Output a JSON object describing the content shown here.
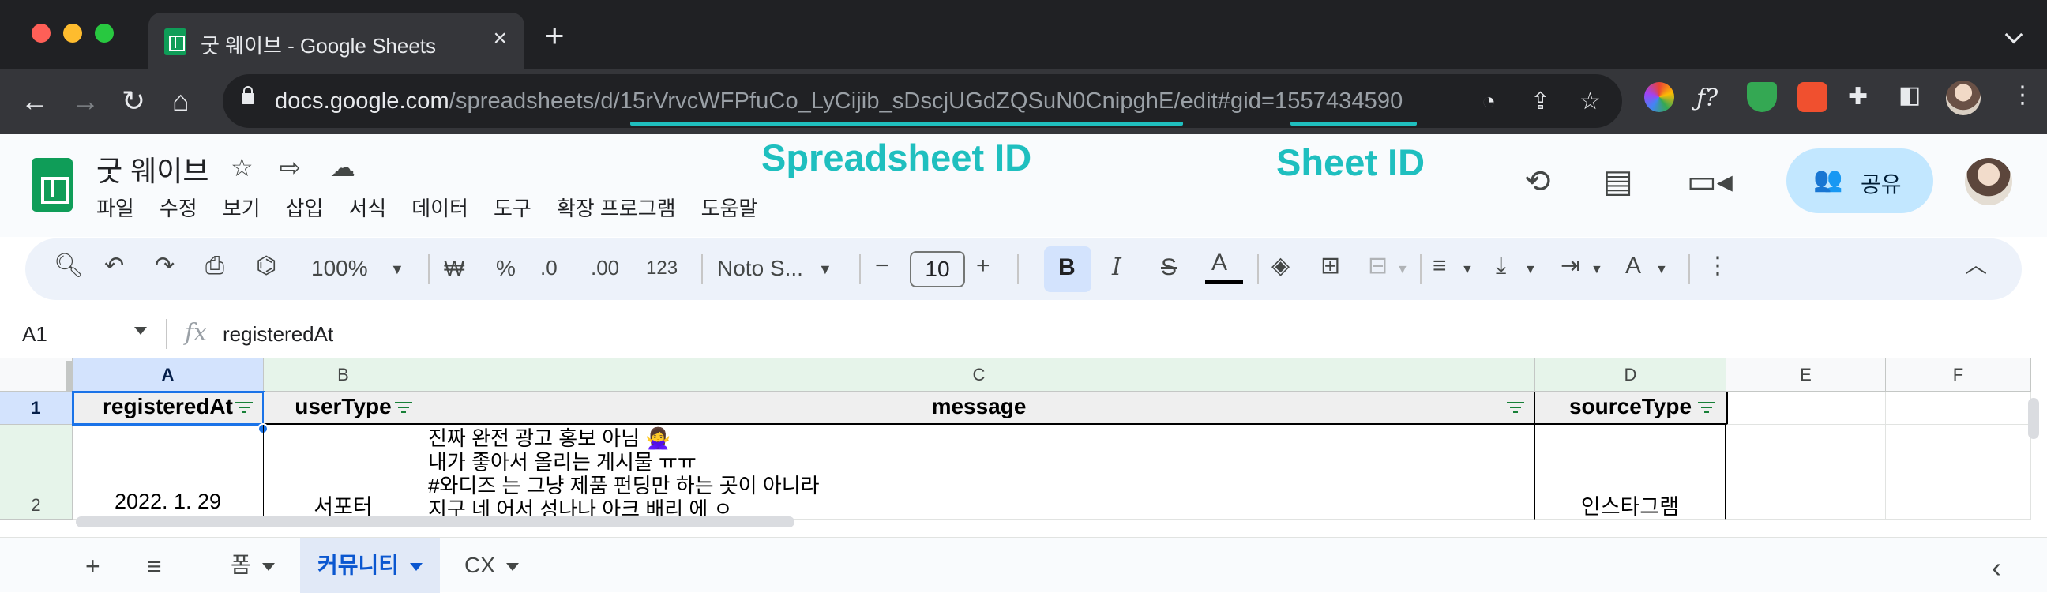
{
  "browser": {
    "tab_title": "굿 웨이브 - Google Sheets",
    "tab_close": "×",
    "new_tab": "+",
    "url_host": "docs.google.com",
    "url_path": "/spreadsheets/d/15rVrvcWFPfuCo_LyCijib_sDscjUGdZQSuN0CnipghE/edit#gid=1557434590",
    "nav": {
      "back": "←",
      "forward": "→",
      "reload": "↻",
      "home": "⌂"
    },
    "omni_icons": [
      "speedometer-icon",
      "share-icon",
      "star-icon"
    ],
    "extensions": [
      "color-picker-icon",
      "formula-icon",
      "shield-icon",
      "translate-icon",
      "puzzle-icon",
      "sidebar-icon"
    ]
  },
  "sheets": {
    "doc_title": "굿 웨이브",
    "menu": [
      "파일",
      "수정",
      "보기",
      "삽입",
      "서식",
      "데이터",
      "도구",
      "확장 프로그램",
      "도움말"
    ],
    "share_label": "공유"
  },
  "annotations": {
    "spreadsheet_id_label": "Spreadsheet ID",
    "sheet_id_label": "Sheet ID",
    "accent_color": "#1fbfbf"
  },
  "format_toolbar": {
    "zoom": "100%",
    "currency": "₩",
    "percent": "%",
    "decrease_decimal": ".0",
    "increase_decimal": ".00",
    "number_format": "123",
    "font": "Noto S...",
    "font_size": "10",
    "bold": "B",
    "italic": "I",
    "strike": "S",
    "text_color": "A"
  },
  "formula_bar": {
    "cell_ref": "A1",
    "fx": "fx",
    "value": "registeredAt"
  },
  "grid": {
    "columns": [
      "A",
      "B",
      "C",
      "D",
      "E",
      "F"
    ],
    "rows": [
      "1",
      "2"
    ],
    "headers": [
      "registeredAt",
      "userType",
      "message",
      "sourceType"
    ],
    "row2": {
      "registeredAt": "2022. 1. 29",
      "userType": "서포터",
      "message_lines": [
        "진짜 완전 광고 홍보 아님 🙅‍♀️",
        "내가 좋아서 올리는 게시물 ㅠㅠ",
        "#와디즈 는 그냥 제품 펀딩만 하는 곳이 아니라",
        "지구 네 어서 성나나 아크 배리 에 ㅇ"
      ],
      "sourceType": "인스타그램"
    }
  },
  "sheet_tabs": {
    "add": "+",
    "list": "≡",
    "tabs": [
      {
        "label": "폼",
        "active": false
      },
      {
        "label": "커뮤니티",
        "active": true
      },
      {
        "label": "CX",
        "active": false
      }
    ],
    "collapse": "‹"
  }
}
